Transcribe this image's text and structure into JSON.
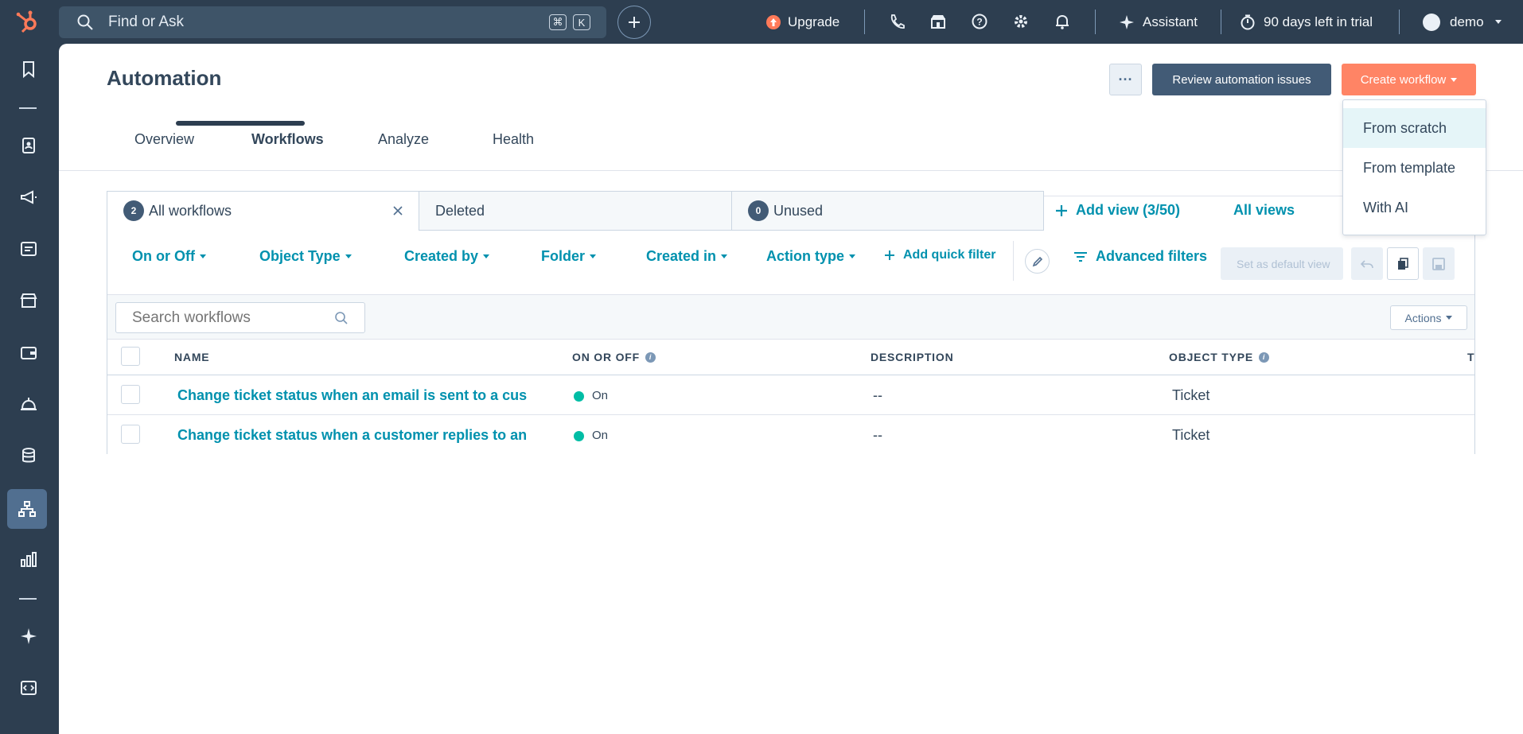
{
  "topnav": {
    "search_placeholder": "Find or Ask",
    "shortcut_cmd": "⌘",
    "shortcut_key": "K",
    "upgrade": "Upgrade",
    "assistant": "Assistant",
    "trial": "90 days left in trial",
    "account": "demo"
  },
  "page": {
    "title": "Automation",
    "more_label": "···",
    "review_label": "Review automation issues",
    "create_label": "Create workflow"
  },
  "tabs": [
    "Overview",
    "Workflows",
    "Analyze",
    "Health"
  ],
  "views": {
    "all_count": "2",
    "all_label": "All workflows",
    "deleted_label": "Deleted",
    "unused_count": "0",
    "unused_label": "Unused",
    "add_view": "Add view (3/50)",
    "all_views": "All views"
  },
  "filters": {
    "on_off": "On or Off",
    "object_type": "Object Type",
    "created_by": "Created by",
    "folder": "Folder",
    "created_in": "Created in",
    "action_type": "Action type",
    "add_quick": "Add quick filter",
    "advanced": "Advanced filters",
    "set_default": "Set as default view"
  },
  "table": {
    "search_placeholder": "Search workflows",
    "actions_label": "Actions",
    "headers": {
      "name": "NAME",
      "on_off": "ON OR OFF",
      "description": "DESCRIPTION",
      "object_type": "OBJECT TYPE",
      "truncated": "T"
    },
    "rows": [
      {
        "name": "Change ticket status when an email is sent to a cus",
        "status": "On",
        "description": "--",
        "object_type": "Ticket"
      },
      {
        "name": "Change ticket status when a customer replies to an",
        "status": "On",
        "description": "--",
        "object_type": "Ticket"
      }
    ]
  },
  "dropdown": {
    "items": [
      "From scratch",
      "From template",
      "With AI"
    ]
  },
  "colors": {
    "nav_bg": "#2d3e50",
    "accent_orange": "#ff7a59",
    "link_blue": "#0091ae",
    "status_on": "#00bda5"
  }
}
